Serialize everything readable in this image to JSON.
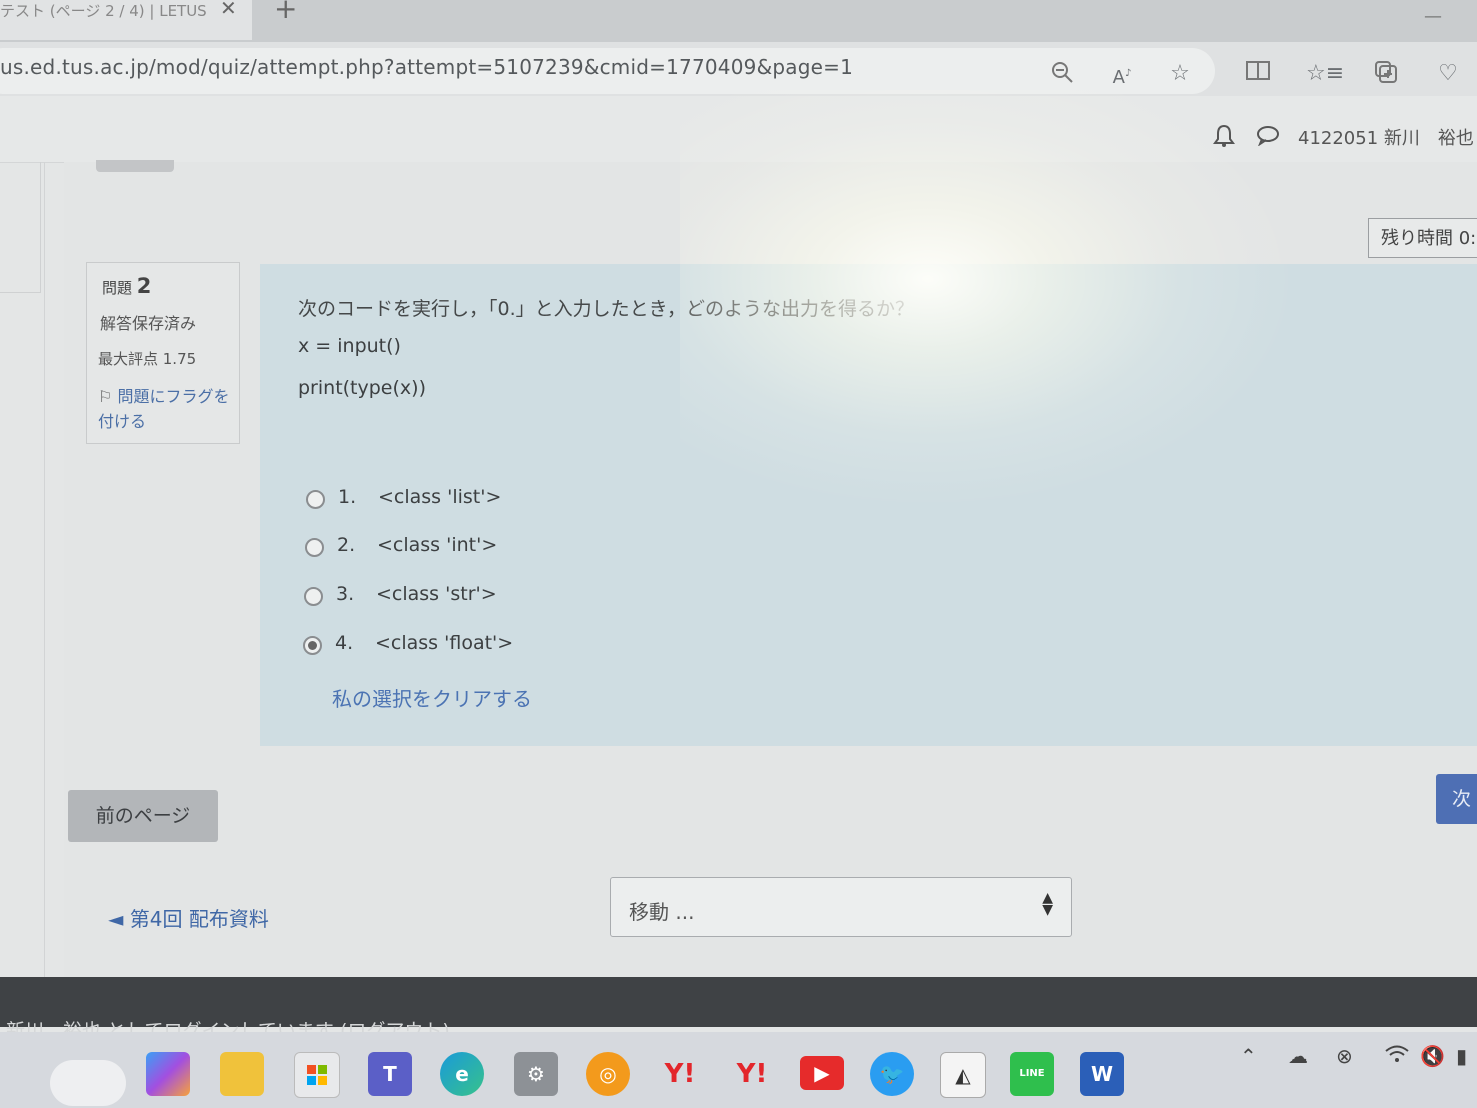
{
  "browser": {
    "tab_title": "テスト (ページ 2 / 4) | LETUS",
    "tab_close": "✕",
    "new_tab": "+",
    "url": "us.ed.tus.ac.jp/mod/quiz/attempt.php?attempt=5107239&cmid=1770409&page=1"
  },
  "header": {
    "user": "4122051 新川　裕也"
  },
  "timer": {
    "label": "残り時間 0:"
  },
  "question_info": {
    "label": "問題",
    "number": "2",
    "state": "解答保存済み",
    "max_grade": "最大評点 1.75",
    "flag": "問題にフラグを付ける"
  },
  "question": {
    "text": "次のコードを実行し，「0.」と入力したとき，どのような出力を得るか？",
    "code": [
      "x = input()",
      "print(type(x))"
    ],
    "options": [
      {
        "num": "1.",
        "text": "<class 'list'>",
        "selected": false
      },
      {
        "num": "2.",
        "text": "<class 'int'>",
        "selected": false
      },
      {
        "num": "3.",
        "text": "<class 'str'>",
        "selected": false
      },
      {
        "num": "4.",
        "text": "<class 'float'>",
        "selected": true
      }
    ],
    "clear": "私の選択をクリアする"
  },
  "nav": {
    "prev": "前のページ",
    "next": "次",
    "back_link": "◄ 第4回 配布資料",
    "jump": "移動 ..."
  },
  "footer": {
    "text": "新川　裕也 としてログインしています (ログアウト)"
  },
  "taskbar": {
    "apps": [
      "copilot-icon",
      "file-explorer-icon",
      "store-icon",
      "teams-icon",
      "edge-icon",
      "settings-icon",
      "app-orange-icon",
      "yahoo-icon",
      "yahoo-icon",
      "youtube-icon",
      "twitter-icon",
      "app-outline-icon",
      "line-icon",
      "word-icon"
    ],
    "labels": {
      "yahoo": "Y!",
      "word": "W",
      "line": "LINE"
    }
  }
}
